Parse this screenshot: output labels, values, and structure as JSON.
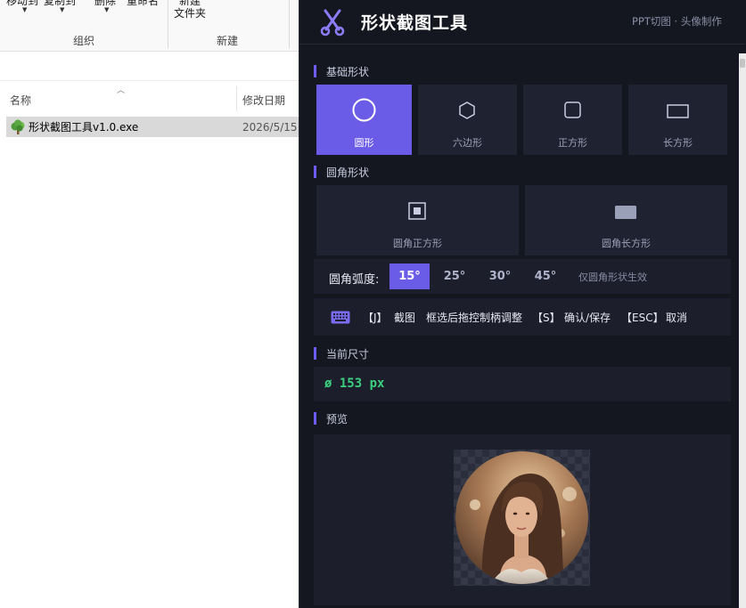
{
  "explorer": {
    "ribbon": {
      "move_to": "移动到",
      "copy_to": "复制到",
      "delete": "删除",
      "rename": "重命名",
      "new_top": "新建",
      "new_folder": "文件夹",
      "group_organize": "组织",
      "group_new": "新建"
    },
    "columns": {
      "name": "名称",
      "modified": "修改日期"
    },
    "files": [
      {
        "name": "形状截图工具v1.0.exe",
        "date": "2026/5/15"
      }
    ]
  },
  "app": {
    "title": "形状截图工具",
    "subtitle": "PPT切图 · 头像制作",
    "accent": "#6b5ce7",
    "sections": {
      "basic": "基础形状",
      "rounded": "圆角形状",
      "current_size": "当前尺寸",
      "preview": "预览"
    },
    "basic_shapes": [
      {
        "label": "圆形",
        "icon": "circle-icon",
        "active": true
      },
      {
        "label": "六边形",
        "icon": "hexagon-icon",
        "active": false
      },
      {
        "label": "正方形",
        "icon": "square-icon",
        "active": false
      },
      {
        "label": "长方形",
        "icon": "rectangle-icon",
        "active": false
      }
    ],
    "rounded_shapes": [
      {
        "label": "圆角正方形",
        "icon": "rounded-square-icon"
      },
      {
        "label": "圆角长方形",
        "icon": "rounded-rectangle-icon"
      }
    ],
    "radius": {
      "label": "圆角弧度:",
      "options": [
        "15°",
        "25°",
        "30°",
        "45°"
      ],
      "selected": "15°",
      "note": "仅圆角形状生效"
    },
    "shortcuts": {
      "j_key": "【J】",
      "j_action": "截图",
      "adjust": "框选后拖控制柄调整",
      "s_key": "【S】",
      "s_action": "确认/保存",
      "esc_key": "【ESC】",
      "esc_action": "取消"
    },
    "size_value": "ø 153 px"
  }
}
